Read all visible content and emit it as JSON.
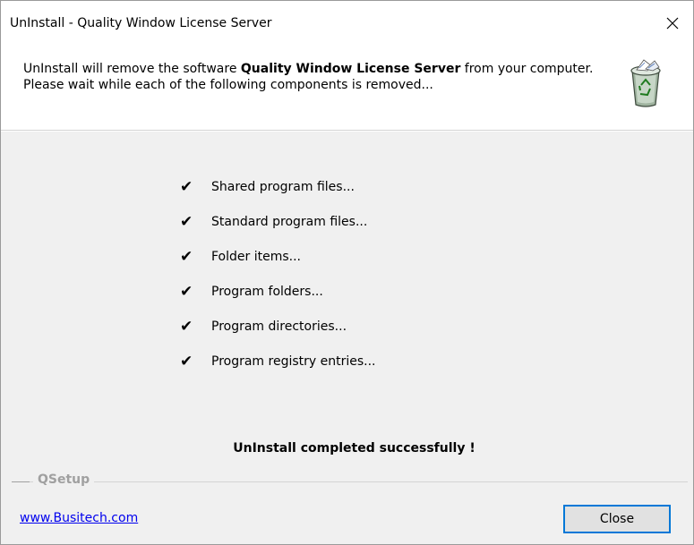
{
  "window": {
    "title": "UnInstall - Quality Window License Server"
  },
  "header": {
    "message_prefix": "UnInstall will remove the software ",
    "product_name": "Quality Window License Server",
    "message_suffix": " from your computer. Please wait while each of the following components is removed...",
    "icon": "recycle-bin-icon"
  },
  "steps": [
    {
      "label": "Shared program files...",
      "status_icon": "checkmark"
    },
    {
      "label": "Standard program files...",
      "status_icon": "checkmark"
    },
    {
      "label": "Folder items...",
      "status_icon": "checkmark"
    },
    {
      "label": "Program folders...",
      "status_icon": "checkmark"
    },
    {
      "label": "Program directories...",
      "status_icon": "checkmark"
    },
    {
      "label": "Program registry entries...",
      "status_icon": "checkmark"
    }
  ],
  "check_glyph": "✔",
  "status_message": "UnInstall completed successfully !",
  "footer": {
    "group_label": "QSetup",
    "link_text": "www.Busitech.com",
    "close_label": "Close"
  },
  "colors": {
    "accent": "#0078d7",
    "link": "#0000ee",
    "body_bg": "#f0f0f0"
  }
}
